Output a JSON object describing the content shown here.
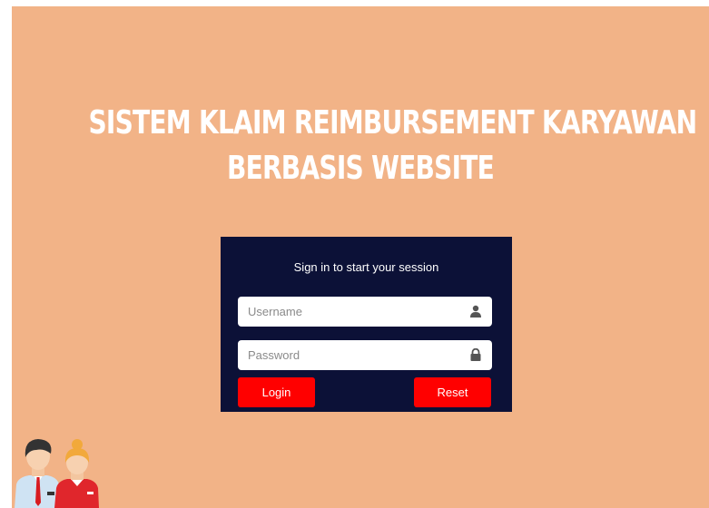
{
  "header": {
    "title_line1": "SISTEM KLAIM REIMBURSEMENT KARYAWAN",
    "title_line2": "BERBASIS WEBSITE"
  },
  "login": {
    "message": "Sign in to start your session",
    "username_placeholder": "Username",
    "password_placeholder": "Password",
    "login_label": "Login",
    "reset_label": "Reset"
  },
  "icons": {
    "username": "user-icon",
    "password": "lock-icon"
  },
  "colors": {
    "background": "#f2b387",
    "panel": "#0c1137",
    "button": "#ff0000",
    "title": "#ffffff"
  }
}
